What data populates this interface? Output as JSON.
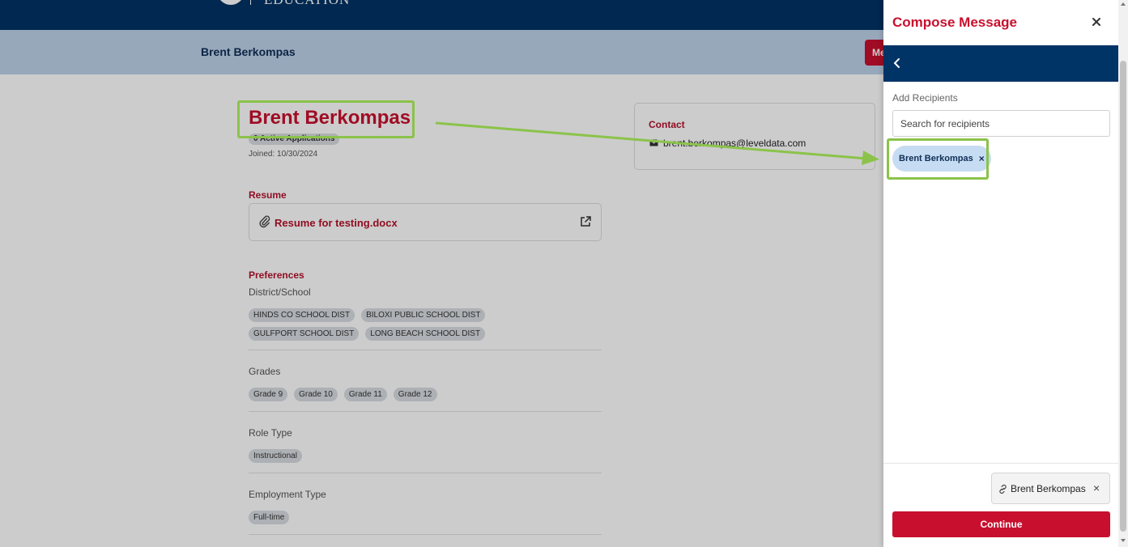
{
  "header": {
    "logo_text": "EDUCATION",
    "page_title": "Brent Berkompas",
    "message_button": "Me"
  },
  "profile": {
    "name": "Brent Berkompas",
    "active_applications": "0 Active Applications",
    "joined": "Joined: 10/30/2024"
  },
  "resume": {
    "label": "Resume",
    "file_name": "Resume for testing.docx"
  },
  "preferences": {
    "label": "Preferences",
    "district_label": "District/School",
    "districts": [
      "HINDS CO SCHOOL DIST",
      "BILOXI PUBLIC SCHOOL DIST",
      "GULFPORT SCHOOL DIST",
      "LONG BEACH SCHOOL DIST"
    ],
    "grades_label": "Grades",
    "grades": [
      "Grade 9",
      "Grade 10",
      "Grade 11",
      "Grade 12"
    ],
    "role_label": "Role Type",
    "roles": [
      "Instructional"
    ],
    "employment_label": "Employment Type",
    "employment": [
      "Full-time"
    ]
  },
  "contact": {
    "label": "Contact",
    "email": "brent.berkompas@leveldata.com"
  },
  "compose": {
    "title": "Compose Message",
    "add_recipients_label": "Add Recipients",
    "search_placeholder": "Search for recipients",
    "recipients": [
      "Brent Berkompas"
    ],
    "remove_symbol": "×",
    "attachment_label": "Brent Berkompas",
    "continue_label": "Continue"
  },
  "colors": {
    "brand_navy": "#003366",
    "brand_red": "#c8102e",
    "highlight_green": "#8bc34a"
  },
  "icons": [
    "close-icon",
    "chevron-left-icon",
    "paperclip-icon",
    "external-link-icon",
    "mail-icon",
    "link-icon"
  ]
}
